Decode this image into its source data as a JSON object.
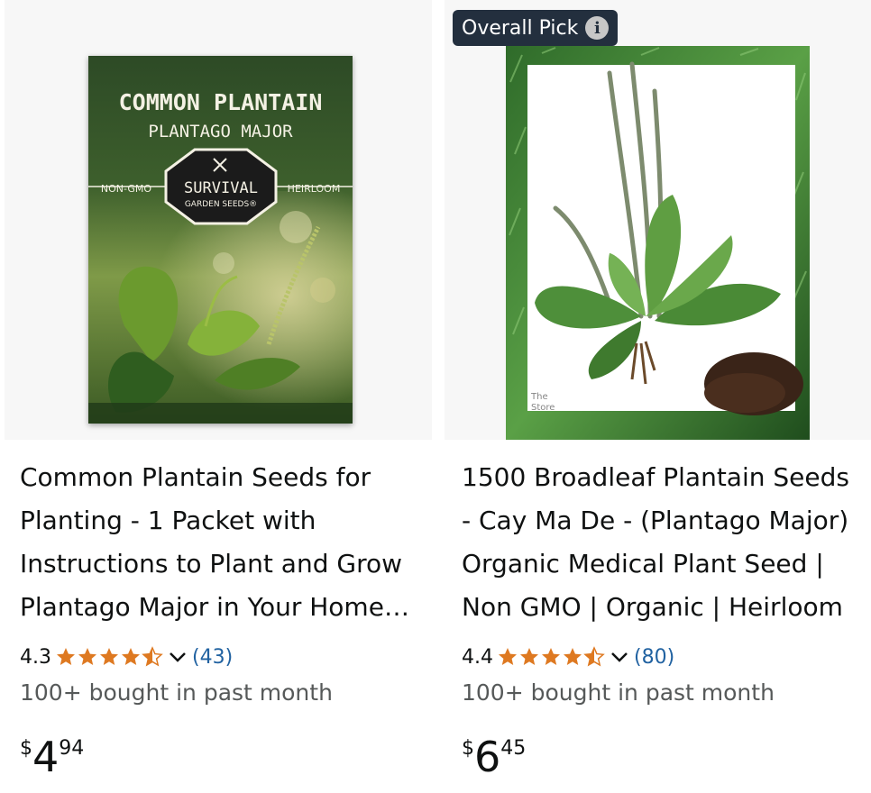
{
  "products": [
    {
      "title": "Common Plantain Seeds for Planting - 1 Packet with Instructions to Plant and Grow Plantago Major in Your Home Vegetable Garden",
      "image": {
        "packet_title": "COMMON PLANTAIN",
        "packet_subtitle": "PLANTAGO MAJOR",
        "left_tag": "NON-GMO",
        "right_tag": "HEIRLOOM",
        "brand_top": "SURVIVAL",
        "brand_bottom": "GARDEN SEEDS®"
      },
      "rating": "4.3",
      "stars": 4.5,
      "review_count": "(43)",
      "bought": "100+ bought in past month",
      "price": {
        "symbol": "$",
        "whole": "4",
        "fraction": "94"
      }
    },
    {
      "badge": "Overall Pick",
      "title": "1500 Broadleaf Plantain Seeds - Cay Ma De - (Plantago Major) Organic Medical Plant Seed | Non GMO | Organic | Heirloom",
      "rating": "4.4",
      "stars": 4.5,
      "review_count": "(80)",
      "bought": "100+ bought in past month",
      "price": {
        "symbol": "$",
        "whole": "6",
        "fraction": "45"
      }
    }
  ],
  "colors": {
    "star": "#de7921",
    "link": "#2162a1",
    "badge_bg": "#232f3e",
    "muted_text": "#565959"
  },
  "icons": [
    "info-icon",
    "star-icon",
    "half-star-icon",
    "chevron-down-icon"
  ]
}
